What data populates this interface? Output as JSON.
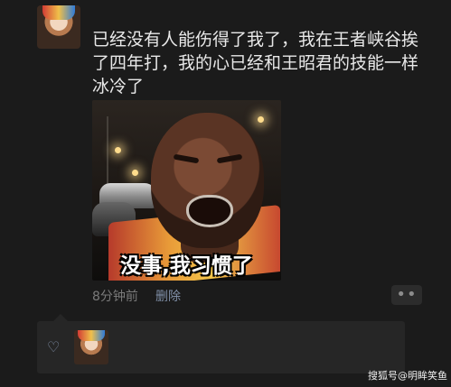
{
  "post": {
    "text": "已经没有人能伤得了我了，我在王者峡谷挨\n了四年打，我的心已经和王昭君的技能一样\n冰冷了",
    "image_caption": "没事,我习惯了",
    "time": "8分钟前",
    "delete_label": "删除",
    "more_label": "••"
  },
  "likes": {
    "heart_icon": "♡"
  },
  "watermark": "搜狐号@明眸笑鱼"
}
